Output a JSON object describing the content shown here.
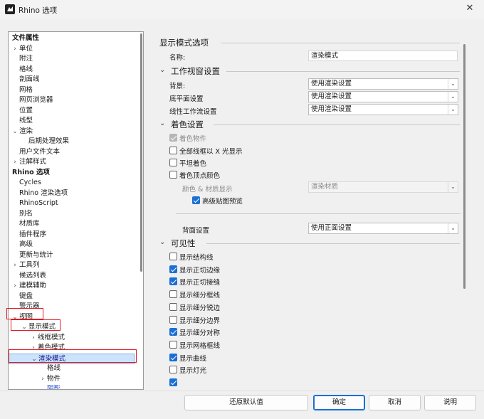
{
  "window": {
    "title": "Rhino 选项",
    "close_glyph": "✕"
  },
  "tree": {
    "items": [
      {
        "label": "文件属性",
        "indent": 0,
        "arrow": "",
        "header": true
      },
      {
        "label": "单位",
        "indent": 1,
        "arrow": "›"
      },
      {
        "label": "附注",
        "indent": 1,
        "arrow": ""
      },
      {
        "label": "格线",
        "indent": 1,
        "arrow": ""
      },
      {
        "label": "剖面线",
        "indent": 1,
        "arrow": ""
      },
      {
        "label": "网格",
        "indent": 1,
        "arrow": ""
      },
      {
        "label": "网页浏览器",
        "indent": 1,
        "arrow": ""
      },
      {
        "label": "位置",
        "indent": 1,
        "arrow": ""
      },
      {
        "label": "线型",
        "indent": 1,
        "arrow": ""
      },
      {
        "label": "渲染",
        "indent": 1,
        "arrow": "⌄"
      },
      {
        "label": "后期处理效果",
        "indent": 2,
        "arrow": ""
      },
      {
        "label": "用户文件文本",
        "indent": 1,
        "arrow": ""
      },
      {
        "label": "注解样式",
        "indent": 1,
        "arrow": "›"
      },
      {
        "label": "Rhino 选项",
        "indent": 0,
        "arrow": "",
        "header": true
      },
      {
        "label": "Cycles",
        "indent": 1,
        "arrow": ""
      },
      {
        "label": "Rhino 渲染选项",
        "indent": 1,
        "arrow": ""
      },
      {
        "label": "RhinoScript",
        "indent": 1,
        "arrow": ""
      },
      {
        "label": "别名",
        "indent": 1,
        "arrow": ""
      },
      {
        "label": "材质库",
        "indent": 1,
        "arrow": ""
      },
      {
        "label": "插件程序",
        "indent": 1,
        "arrow": ""
      },
      {
        "label": "高级",
        "indent": 1,
        "arrow": ""
      },
      {
        "label": "更新与统计",
        "indent": 1,
        "arrow": ""
      },
      {
        "label": "工具列",
        "indent": 1,
        "arrow": "›"
      },
      {
        "label": "候选列表",
        "indent": 1,
        "arrow": ""
      },
      {
        "label": "建模辅助",
        "indent": 1,
        "arrow": "›"
      },
      {
        "label": "键盘",
        "indent": 1,
        "arrow": ""
      },
      {
        "label": "警示器",
        "indent": 1,
        "arrow": ""
      },
      {
        "label": "视图",
        "indent": 1,
        "arrow": "⌄"
      },
      {
        "label": "显示模式",
        "indent": 2,
        "arrow": "⌄"
      },
      {
        "label": "线框模式",
        "indent": 3,
        "arrow": "›"
      },
      {
        "label": "着色模式",
        "indent": 3,
        "arrow": "›"
      },
      {
        "label": "渲染模式",
        "indent": 3,
        "arrow": "⌄",
        "selected": true
      },
      {
        "label": "格线",
        "indent": 4,
        "arrow": ""
      },
      {
        "label": "物件",
        "indent": 4,
        "arrow": "›"
      },
      {
        "label": "阴影",
        "indent": 4,
        "arrow": "",
        "partial": true
      }
    ]
  },
  "settings": {
    "section_display_mode": "显示模式选项",
    "name_label": "名称:",
    "name_value": "渲染模式",
    "section_viewport": "工作视窗设置",
    "background_label": "背景:",
    "background_value": "使用渲染设置",
    "groundplane_label": "底平面设置",
    "groundplane_value": "使用渲染设置",
    "linear_label": "线性工作流设置",
    "linear_value": "使用渲染设置",
    "section_shading": "着色设置",
    "shade_objects": "着色物件",
    "all_wire_xray": "全部线框以 X 光显示",
    "flat_shading": "平坦着色",
    "vertex_colors": "着色顶点颜色",
    "color_material_label": "颜色 & 材质显示",
    "color_material_value": "渲染材质",
    "advanced_texture": "高级贴图预览",
    "backface_label": "背面设置",
    "backface_value": "使用正面设置",
    "section_visibility": "可见性",
    "visibility_items": [
      {
        "label": "显示结构线",
        "checked": false
      },
      {
        "label": "显示正切边缘",
        "checked": true
      },
      {
        "label": "显示正切接缝",
        "checked": true
      },
      {
        "label": "显示细分框线",
        "checked": false
      },
      {
        "label": "显示细分锐边",
        "checked": false
      },
      {
        "label": "显示细分边界",
        "checked": false
      },
      {
        "label": "显示细分对称",
        "checked": true
      },
      {
        "label": "显示网格框线",
        "checked": false
      },
      {
        "label": "显示曲线",
        "checked": true
      },
      {
        "label": "显示灯光",
        "checked": false
      }
    ]
  },
  "buttons": {
    "restore": "还原默认值",
    "ok": "确定",
    "cancel": "取消",
    "help": "说明"
  },
  "colors": {
    "accent": "#1a6fd4",
    "highlight_box": "#e11b22",
    "selection_bg": "#cde3fb"
  }
}
